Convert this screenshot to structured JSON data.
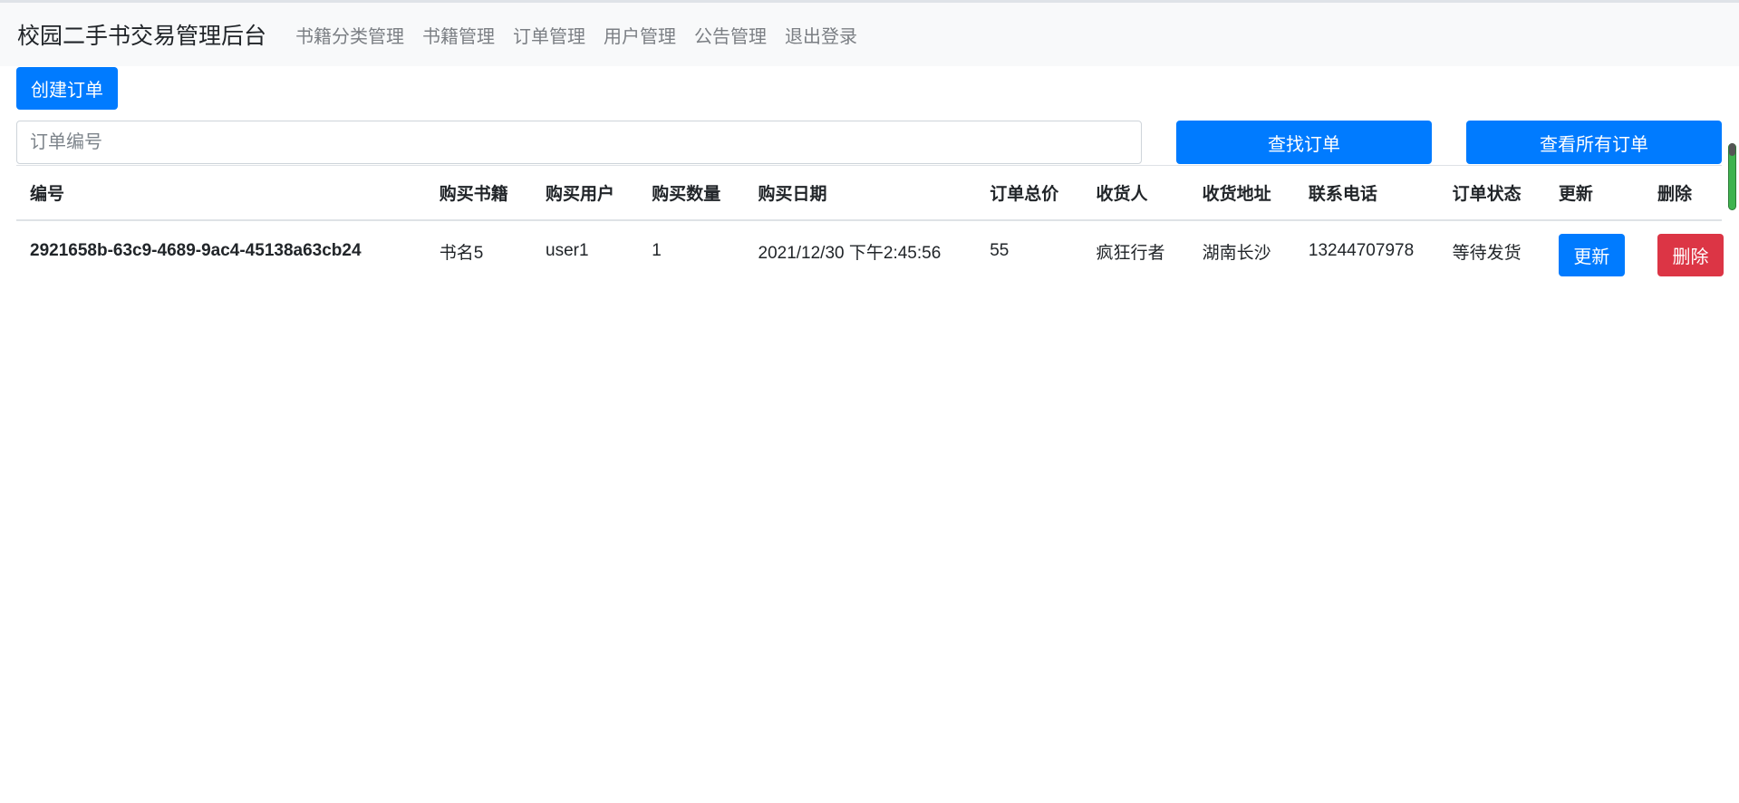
{
  "navbar": {
    "brand": "校园二手书交易管理后台",
    "links": [
      "书籍分类管理",
      "书籍管理",
      "订单管理",
      "用户管理",
      "公告管理",
      "退出登录"
    ]
  },
  "toolbar": {
    "create_label": "创建订单",
    "search_placeholder": "订单编号",
    "search_value": "",
    "find_label": "查找订单",
    "view_all_label": "查看所有订单"
  },
  "table": {
    "headers": [
      "编号",
      "购买书籍",
      "购买用户",
      "购买数量",
      "购买日期",
      "订单总价",
      "收货人",
      "收货地址",
      "联系电话",
      "订单状态",
      "更新",
      "删除"
    ],
    "rows": [
      {
        "id": "2921658b-63c9-4689-9ac4-45138a63cb24",
        "book": "书名5",
        "user": "user1",
        "quantity": "1",
        "date": "2021/12/30 下午2:45:56",
        "total": "55",
        "receiver": "疯狂行者",
        "address": "湖南长沙",
        "phone": "13244707978",
        "status": "等待发货",
        "update_label": "更新",
        "delete_label": "删除"
      }
    ]
  }
}
